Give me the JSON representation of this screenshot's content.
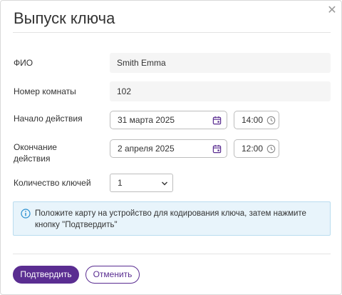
{
  "dialog": {
    "title": "Выпуск ключа",
    "close_icon": "close-icon"
  },
  "form": {
    "name": {
      "label": "ФИО",
      "value": "Smith Emma"
    },
    "room": {
      "label": "Номер комнаты",
      "value": "102"
    },
    "start": {
      "label": "Начало действия",
      "date": "31 марта 2025",
      "time": "14:00"
    },
    "end": {
      "label_line1": "Окончание",
      "label_line2": "действия",
      "date": "2 апреля 2025",
      "time": "12:00"
    },
    "keys": {
      "label": "Количество ключей",
      "value": "1"
    }
  },
  "info": {
    "text": "Положите карту на устройство для кодирования ключа, затем нажмите кнопку \"Подтвердить\"",
    "icon": "info-icon",
    "color": "#e8f4fb"
  },
  "actions": {
    "confirm_label": "Подтвердить",
    "cancel_label": "Отменить",
    "accent": "#5a2d91"
  }
}
